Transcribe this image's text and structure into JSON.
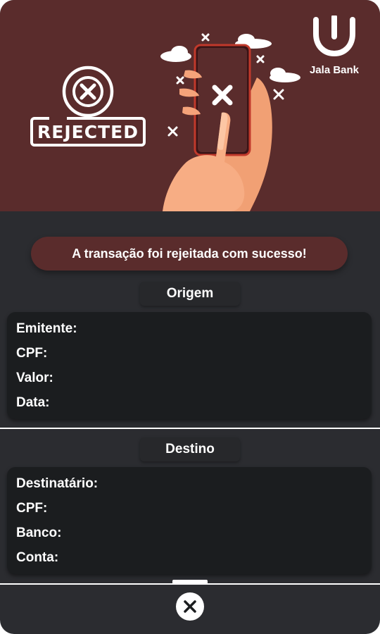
{
  "brand": {
    "name": "Jala Bank"
  },
  "hero": {
    "stamp_text": "REJECTED"
  },
  "message": "A transação foi rejeitada com sucesso!",
  "origem": {
    "title": "Origem",
    "fields": [
      "Emitente:",
      "CPF:",
      "Valor:",
      "Data:"
    ]
  },
  "destino": {
    "title": "Destino",
    "fields": [
      "Destinatário:",
      "CPF:",
      "Banco:",
      "Conta:"
    ]
  },
  "colors": {
    "hero_bg": "#5a2c2c",
    "panel_bg": "#1b1d1f",
    "card_bg": "#2b2c30",
    "hand": "#f5a37a",
    "accent_red": "#c0392b"
  },
  "icons": {
    "brand": "jala-logo-icon",
    "close": "close-icon"
  }
}
